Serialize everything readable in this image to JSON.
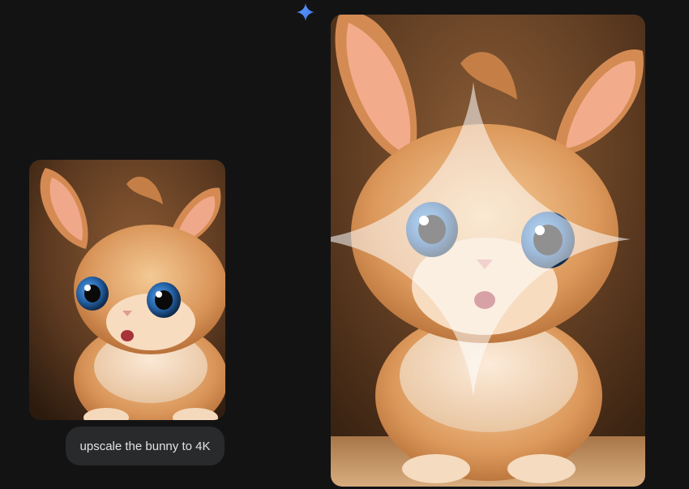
{
  "assistant": {
    "icon": "gemini-sparkle-icon",
    "accent_color": "#4c8df6"
  },
  "user_message": {
    "text": "upscale the bunny to 4K",
    "image": "bunny-original"
  },
  "response": {
    "image": "bunny-upscaled",
    "watermark_icon": "sparkle-watermark-icon"
  },
  "colors": {
    "background": "#131314",
    "bubble": "#282a2c",
    "bubble_text": "#e3e3e3"
  }
}
